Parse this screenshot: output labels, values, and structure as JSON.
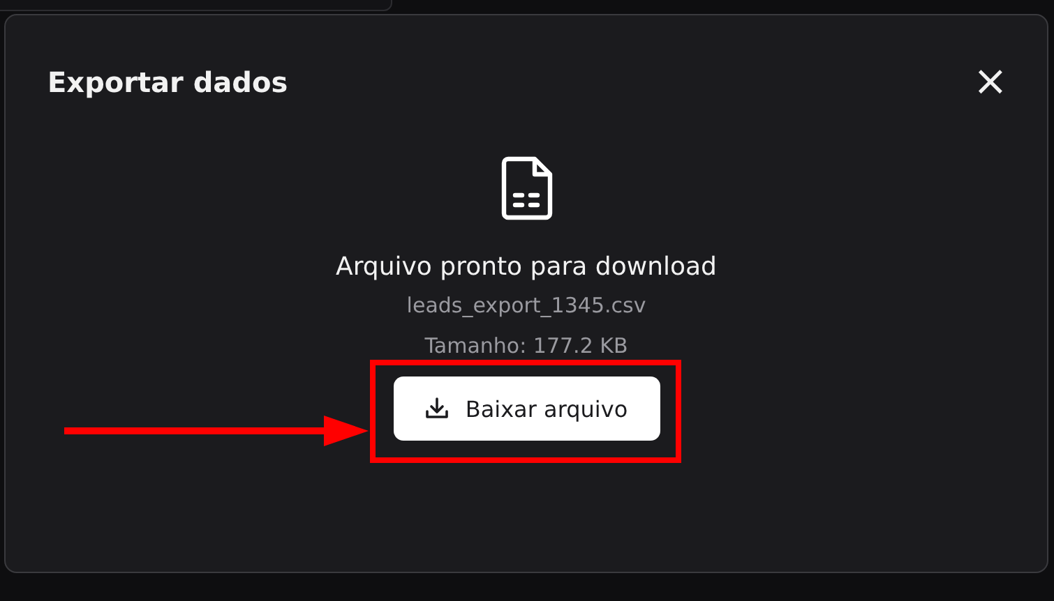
{
  "dialog": {
    "title": "Exportar dados",
    "close": "×",
    "heading": "Arquivo pronto para download",
    "filename": "leads_export_1345.csv",
    "size": "Tamanho: 177.2 KB",
    "button": "Baixar arquivo"
  }
}
